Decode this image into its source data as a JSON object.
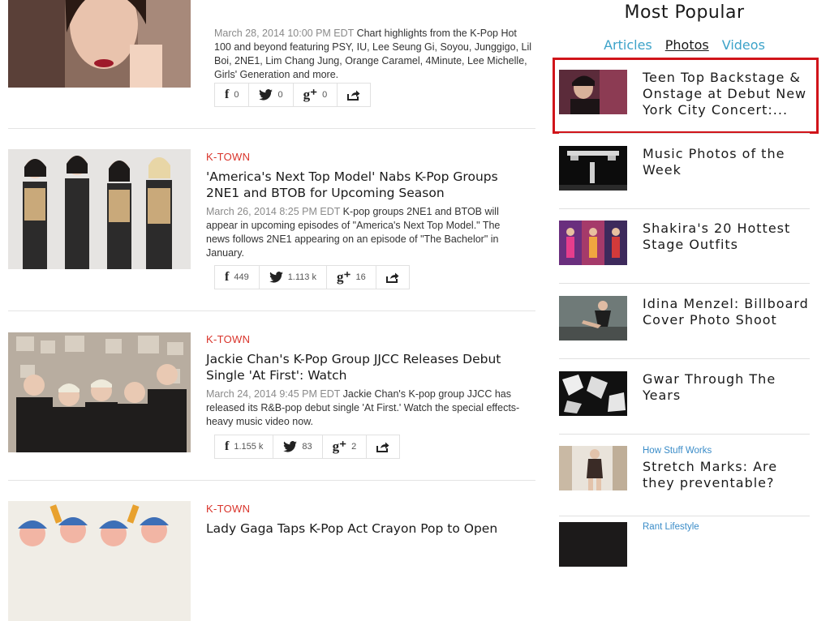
{
  "articles": [
    {
      "category": "",
      "title": "",
      "date": "March 28, 2014 10:00 PM EDT",
      "summary": "Chart highlights from the K-Pop Hot 100 and beyond featuring PSY, IU, Lee Seung Gi, Soyou, Junggigo, Lil Boi, 2NE1, Lim Chang Jung, Orange Caramel, 4Minute, Lee Michelle, Girls' Generation and more.",
      "facebook_count": "0",
      "twitter_count": "0",
      "gplus_count": "0"
    },
    {
      "category": "K-TOWN",
      "title": "'America's Next Top Model' Nabs K-Pop Groups 2NE1 and BTOB for Upcoming Season",
      "date": "March 26, 2014 8:25 PM EDT",
      "summary": "K-pop groups 2NE1 and BTOB will appear in upcoming episodes of \"America's Next Top Model.\" The news follows 2NE1 appearing on an episode of \"The Bachelor\" in January.",
      "facebook_count": "449",
      "twitter_count": "1.113 k",
      "gplus_count": "16"
    },
    {
      "category": "K-TOWN",
      "title": "Jackie Chan's K-Pop Group JJCC Releases Debut Single 'At First': Watch",
      "date": "March 24, 2014 9:45 PM EDT",
      "summary": "Jackie Chan's K-pop group JJCC has released its R&B-pop debut single 'At First.' Watch the special effects-heavy music video now.",
      "facebook_count": "1.155 k",
      "twitter_count": "83",
      "gplus_count": "2"
    },
    {
      "category": "K-TOWN",
      "title": "Lady Gaga Taps K-Pop Act Crayon Pop to Open"
    }
  ],
  "sidebar": {
    "title": "Most Popular",
    "tabs": [
      {
        "label": "Articles"
      },
      {
        "label": "Photos"
      },
      {
        "label": "Videos"
      }
    ],
    "items": [
      {
        "title": "Teen Top Backstage & Onstage at Debut New York City Concert:..."
      },
      {
        "title": "Music Photos of the Week"
      },
      {
        "title": "Shakira's 20 Hottest Stage Outfits"
      },
      {
        "title": "Idina Menzel: Billboard Cover Photo Shoot"
      },
      {
        "title": "Gwar Through The Years"
      },
      {
        "sponsor": "How Stuff Works",
        "title": "Stretch Marks: Are they preventable?"
      },
      {
        "sponsor": "Rant Lifestyle",
        "title": ""
      }
    ]
  },
  "colors": {
    "category": "#d9342b",
    "tab_link": "#3da3c9",
    "sponsor": "#3a8cc8",
    "highlight_box": "#d0141a"
  }
}
